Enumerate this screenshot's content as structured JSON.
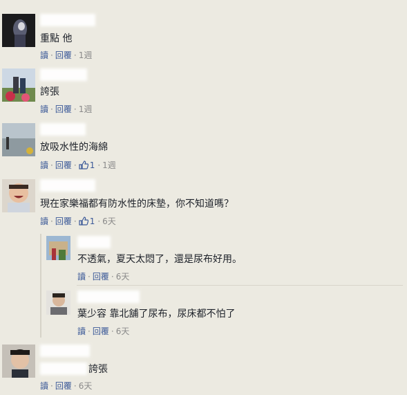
{
  "comments": [
    {
      "text": "重點 他",
      "actions": {
        "read": "讀",
        "reply": "回覆",
        "time": "1週"
      }
    },
    {
      "text": "誇張",
      "actions": {
        "read": "讀",
        "reply": "回覆",
        "time": "1週"
      }
    },
    {
      "text": "放吸水性的海綿",
      "actions": {
        "read": "讀",
        "reply": "回覆",
        "likes": "1",
        "time": "1週"
      }
    },
    {
      "text": "現在家樂福都有防水性的床墊，你不知道嗎？",
      "actions": {
        "read": "讀",
        "reply": "回覆",
        "likes": "1",
        "time": "6天"
      },
      "replies": [
        {
          "text": "不透氣，夏天太悶了，還是尿布好用。",
          "actions": {
            "read": "讀",
            "reply": "回覆",
            "time": "6天"
          }
        },
        {
          "text": "葉少容 靠北舖了尿布，尿床都不怕了",
          "actions": {
            "read": "讀",
            "reply": "回覆",
            "time": "6天"
          }
        }
      ]
    },
    {
      "text": "誇張",
      "actions": {
        "read": "讀",
        "reply": "回覆",
        "time": "6天"
      }
    }
  ],
  "colors": {
    "background": "#eceae1",
    "link": "#3b5998",
    "meta": "#8a8a8a"
  },
  "icons": {
    "like": "thumbs-up-icon"
  }
}
